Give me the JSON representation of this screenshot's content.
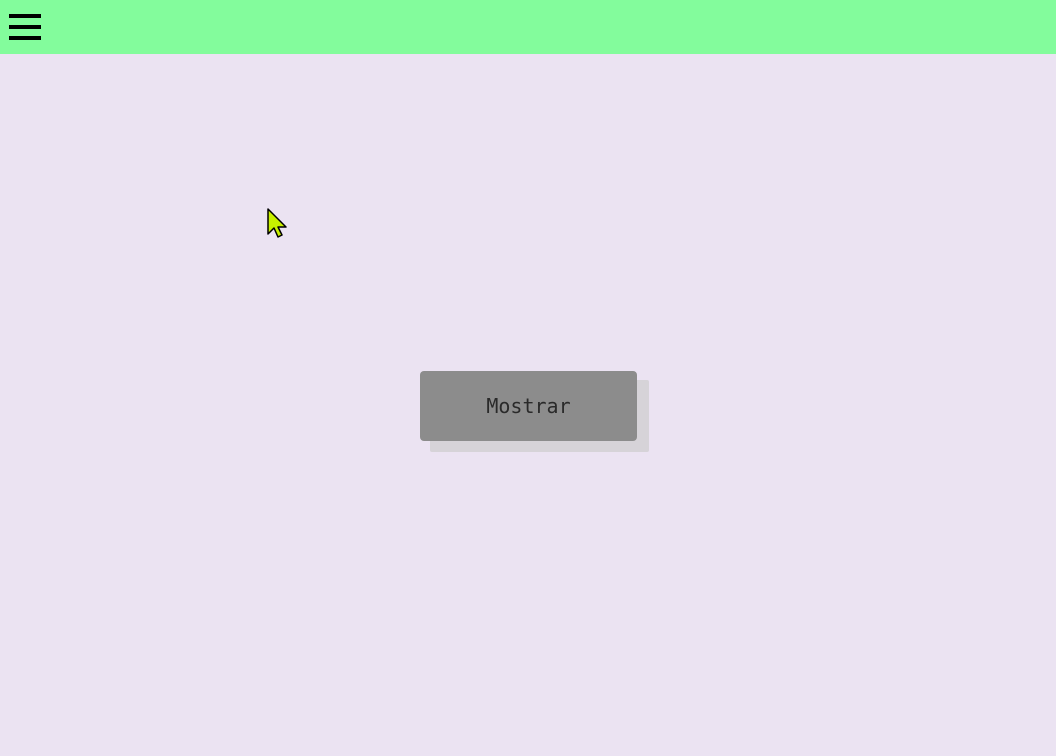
{
  "header": {
    "menu_icon": "hamburger-menu-icon",
    "background_color": "#83fc9c"
  },
  "main": {
    "background_color": "#ebe3f2",
    "show_button_label": "Mostrar",
    "show_button_color": "#8c8c8c"
  },
  "cursor": {
    "icon": "mouse-pointer-icon",
    "color": "#c8f000"
  }
}
